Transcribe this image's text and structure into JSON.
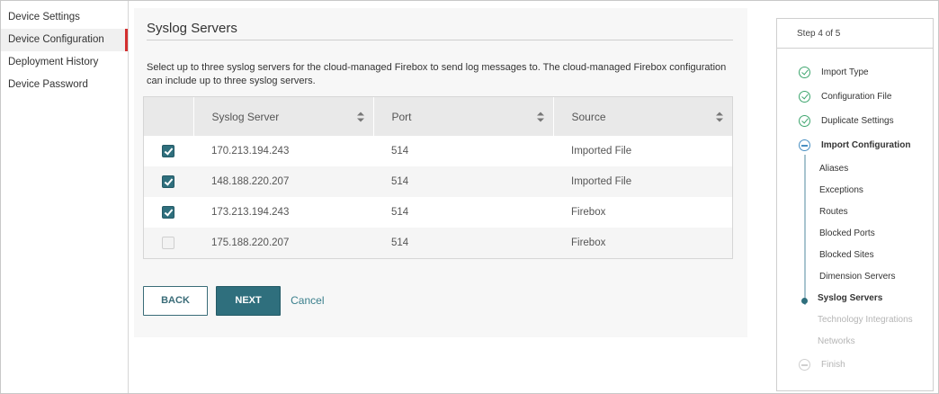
{
  "sidebar": {
    "items": [
      {
        "label": "Device Settings",
        "active": false
      },
      {
        "label": "Device Configuration",
        "active": true
      },
      {
        "label": "Deployment History",
        "active": false
      },
      {
        "label": "Device Password",
        "active": false
      }
    ]
  },
  "main": {
    "title": "Syslog Servers",
    "description": "Select up to three syslog servers for the cloud-managed Firebox to send log messages to. The cloud-managed Firebox configuration can include up to three syslog servers.",
    "table": {
      "columns": [
        "Syslog Server",
        "Port",
        "Source"
      ],
      "rows": [
        {
          "checked": true,
          "server": "170.213.194.243",
          "port": "514",
          "source": "Imported File"
        },
        {
          "checked": true,
          "server": "148.188.220.207",
          "port": "514",
          "source": "Imported File"
        },
        {
          "checked": true,
          "server": "173.213.194.243",
          "port": "514",
          "source": "Firebox"
        },
        {
          "checked": false,
          "server": "175.188.220.207",
          "port": "514",
          "source": "Firebox"
        }
      ]
    },
    "buttons": {
      "back": "BACK",
      "next": "NEXT",
      "cancel": "Cancel"
    }
  },
  "steps": {
    "header": "Step 4 of 5",
    "main_steps": [
      {
        "label": "Import Type",
        "state": "done"
      },
      {
        "label": "Configuration File",
        "state": "done"
      },
      {
        "label": "Duplicate Settings",
        "state": "done"
      },
      {
        "label": "Import Configuration",
        "state": "current"
      }
    ],
    "substeps": [
      {
        "label": "Aliases",
        "state": "done"
      },
      {
        "label": "Exceptions",
        "state": "done"
      },
      {
        "label": "Routes",
        "state": "done"
      },
      {
        "label": "Blocked Ports",
        "state": "done"
      },
      {
        "label": "Blocked Sites",
        "state": "done"
      },
      {
        "label": "Dimension Servers",
        "state": "done"
      },
      {
        "label": "Syslog Servers",
        "state": "current"
      },
      {
        "label": "Technology Integrations",
        "state": "future"
      },
      {
        "label": "Networks",
        "state": "future"
      }
    ],
    "final_step": {
      "label": "Finish",
      "state": "future"
    }
  },
  "colors": {
    "accent": "#2f6f7d",
    "active_nav": "#d32f2f",
    "done_green": "#3fa66f",
    "current_blue": "#4a90c2"
  }
}
